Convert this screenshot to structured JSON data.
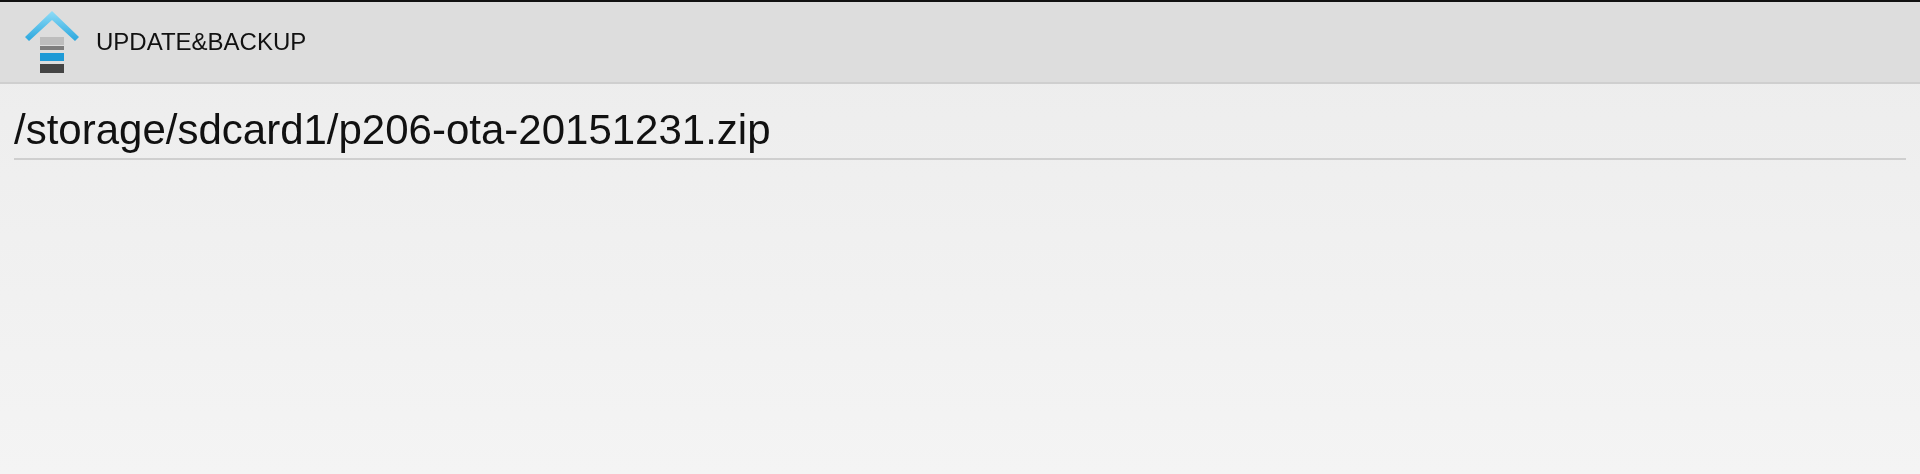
{
  "action_bar": {
    "title": "UPDATE&BACKUP"
  },
  "path_field": {
    "value": "/storage/sdcard1/p206-ota-20151231.zip"
  }
}
